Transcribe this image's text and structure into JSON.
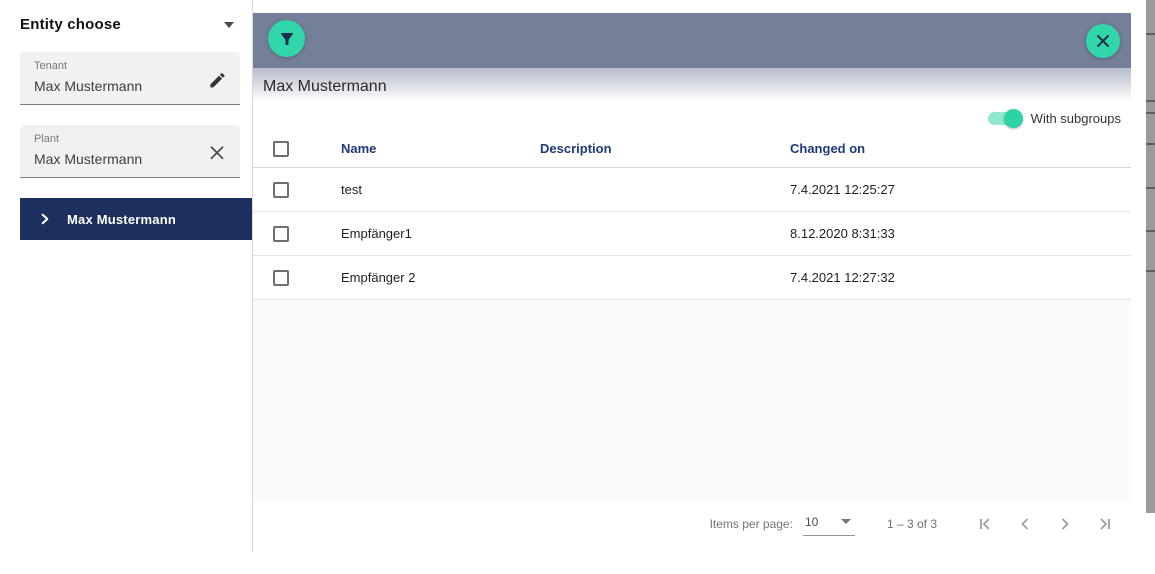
{
  "colors": {
    "accent_teal": "#31d7a9",
    "sidebar_navy": "#1c2f5e",
    "dialog_bar_gray": "#747f9a",
    "table_header_navy": "#20397a"
  },
  "left_panel": {
    "title": "Entity choose",
    "collapse_icon": "caret-down",
    "tenant_field": {
      "label": "Tenant",
      "value": "Max Mustermann",
      "icon": "pencil"
    },
    "plant_field": {
      "label": "Plant",
      "value": "Max Mustermann",
      "icon": "x-clear"
    },
    "tree_item": {
      "label": "Max Mustermann",
      "icon": "chevron-right"
    }
  },
  "dialog": {
    "title": "Max Mustermann",
    "filter_button_icon": "funnel",
    "close_button_icon": "x",
    "subgroups_toggle": {
      "label": "With subgroups",
      "state": "on"
    },
    "table": {
      "columns": [
        "Name",
        "Description",
        "Changed on"
      ],
      "rows": [
        {
          "name": "test",
          "description": "",
          "changed_on": "7.4.2021 12:25:27"
        },
        {
          "name": "Empfänger1",
          "description": "",
          "changed_on": "8.12.2020 8:31:33"
        },
        {
          "name": "Empfänger 2",
          "description": "",
          "changed_on": "7.4.2021 12:27:32"
        }
      ]
    },
    "paginator": {
      "items_per_page_label": "Items per page:",
      "items_per_page_value": "10",
      "range_label": "1 – 3 of 3",
      "nav_icons": [
        "first-page",
        "previous-page",
        "next-page",
        "last-page"
      ]
    }
  }
}
